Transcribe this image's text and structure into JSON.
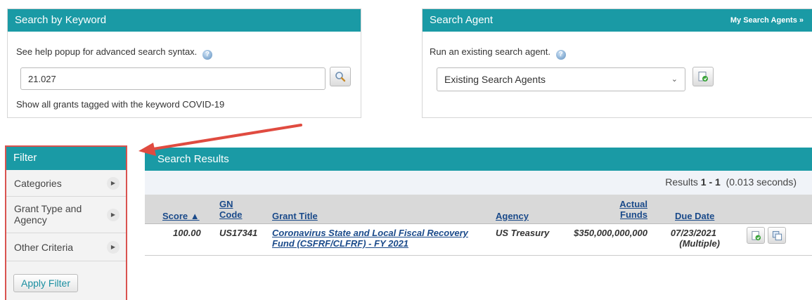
{
  "keyword": {
    "title": "Search by Keyword",
    "hint": "See help popup for advanced search syntax.",
    "input_value": "21.027",
    "covid_link": "Show all grants tagged with the keyword COVID-19"
  },
  "agent": {
    "title": "Search Agent",
    "my_agents_link": "My Search Agents »",
    "hint": "Run an existing search agent.",
    "select_value": "Existing Search Agents"
  },
  "filter": {
    "title": "Filter",
    "items": [
      "Categories",
      "Grant Type and Agency",
      "Other Criteria"
    ],
    "apply_label": "Apply Filter"
  },
  "results": {
    "title": "Search Results",
    "summary_prefix": "Results",
    "summary_range": "1 - 1",
    "summary_time": "(0.013 seconds)",
    "columns": {
      "score": "Score ▲",
      "gn_code_line1": "GN",
      "gn_code_line2": "Code",
      "grant_title": "Grant Title",
      "agency": "Agency",
      "actual_funds_line1": "Actual",
      "actual_funds_line2": "Funds",
      "due_date": "Due Date"
    },
    "rows": [
      {
        "score": "100.00",
        "gn_code": "US17341",
        "title_line1": "Coronavirus State and Local Fiscal Recovery",
        "title_line2": "Fund (CSFRF/CLFRF) - FY 2021",
        "agency": "US Treasury",
        "actual_funds": "$350,000,000,000",
        "due_date_line1": "07/23/2021",
        "due_date_line2": "(Multiple)"
      }
    ]
  },
  "colors": {
    "header": "#1a9aa5",
    "filter_highlight": "#d9534f",
    "link": "#1a4a8a"
  }
}
